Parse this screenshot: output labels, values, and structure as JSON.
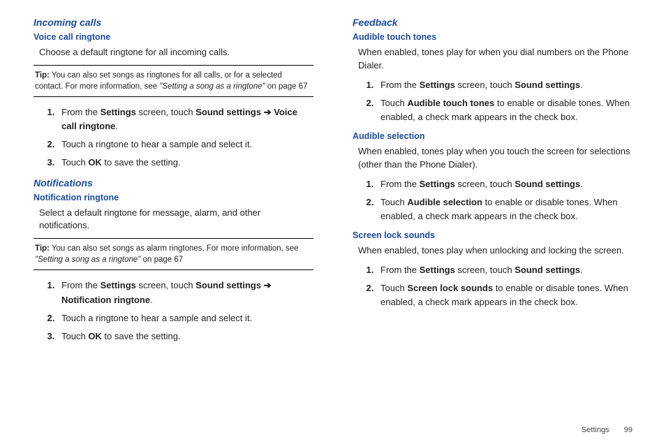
{
  "left": {
    "incoming_calls": {
      "heading": "Incoming calls",
      "voice_call_ringtone": {
        "heading": "Voice call ringtone",
        "intro": "Choose a default ringtone for all incoming calls.",
        "tip_label": "Tip:",
        "tip_prefix": " You can also set songs as ringtones for all calls, or for a selected contact. For more information, see ",
        "tip_quote": "\"Setting a song as a ringtone\"",
        "tip_suffix": " on page 67",
        "steps": {
          "s1a": "From the ",
          "s1b": "Settings",
          "s1c": " screen, touch ",
          "s1d": "Sound settings",
          "s1e": " ➔ ",
          "s1f": "Voice call ringtone",
          "s1g": ".",
          "s2": "Touch a ringtone to hear a sample and select it.",
          "s3a": "Touch ",
          "s3b": "OK",
          "s3c": " to save the setting."
        }
      }
    },
    "notifications": {
      "heading": "Notifications",
      "notification_ringtone": {
        "heading": "Notification ringtone",
        "intro": "Select a default ringtone for message, alarm, and other notifications.",
        "tip_label": "Tip:",
        "tip_prefix": " You can also set songs as alarm ringtones. For more information, see ",
        "tip_quote": "\"Setting a song as a ringtone\"",
        "tip_suffix": " on page 67",
        "steps": {
          "s1a": "From the ",
          "s1b": "Settings",
          "s1c": " screen, touch ",
          "s1d": "Sound settings",
          "s1e": " ➔ ",
          "s1f": "Notification ringtone",
          "s1g": ".",
          "s2": "Touch a ringtone to hear a sample and select it.",
          "s3a": "Touch ",
          "s3b": "OK",
          "s3c": " to save the setting."
        }
      }
    }
  },
  "right": {
    "feedback": {
      "heading": "Feedback",
      "audible_touch_tones": {
        "heading": "Audible touch tones",
        "intro": "When enabled, tones play for when you dial numbers on the Phone Dialer.",
        "steps": {
          "s1a": "From the ",
          "s1b": "Settings",
          "s1c": " screen, touch ",
          "s1d": "Sound settings",
          "s1e": ".",
          "s2a": "Touch ",
          "s2b": "Audible touch tones",
          "s2c": " to enable or disable tones. When enabled, a check mark appears in the check box."
        }
      },
      "audible_selection": {
        "heading": "Audible selection",
        "intro": "When enabled, tones play when you touch the screen for selections (other than the Phone Dialer).",
        "steps": {
          "s1a": "From the ",
          "s1b": "Settings",
          "s1c": " screen, touch ",
          "s1d": "Sound settings",
          "s1e": ".",
          "s2a": "Touch ",
          "s2b": "Audible selection",
          "s2c": " to enable or disable tones. When enabled, a check mark appears in the check box."
        }
      },
      "screen_lock_sounds": {
        "heading": "Screen lock sounds",
        "intro": "When enabled, tones play when unlocking and locking the screen.",
        "steps": {
          "s1a": "From the ",
          "s1b": "Settings",
          "s1c": " screen, touch ",
          "s1d": "Sound settings",
          "s1e": ".",
          "s2a": "Touch ",
          "s2b": "Screen lock sounds",
          "s2c": " to enable or disable tones. When enabled, a check mark appears in the check box."
        }
      }
    }
  },
  "footer": {
    "section": "Settings",
    "page": "99"
  }
}
